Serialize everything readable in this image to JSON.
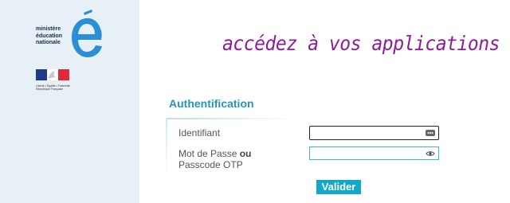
{
  "branding": {
    "logo_lines": [
      "ministère",
      "éducation",
      "nationale"
    ],
    "flag_motto": "Liberté • Égalité • Fraternité",
    "flag_country": "République Française",
    "colors": {
      "logo_blue": "#2a8fd6",
      "sidebar_bg": "#e7f0f7"
    }
  },
  "headline": "accédez à vos applications",
  "form": {
    "title": "Authentification",
    "username_label": "Identifiant",
    "password_label_prefix": "Mot de Passe ",
    "password_label_bold": "ou",
    "password_label_suffix": "Passcode OTP",
    "username_value": "",
    "password_value": "",
    "username_icon": "more-options-icon",
    "password_icon": "eye-icon",
    "submit_label": "Valider"
  },
  "colors": {
    "headline": "#8b1c9a",
    "title": "#2694bb",
    "button": "#12a9c8"
  }
}
